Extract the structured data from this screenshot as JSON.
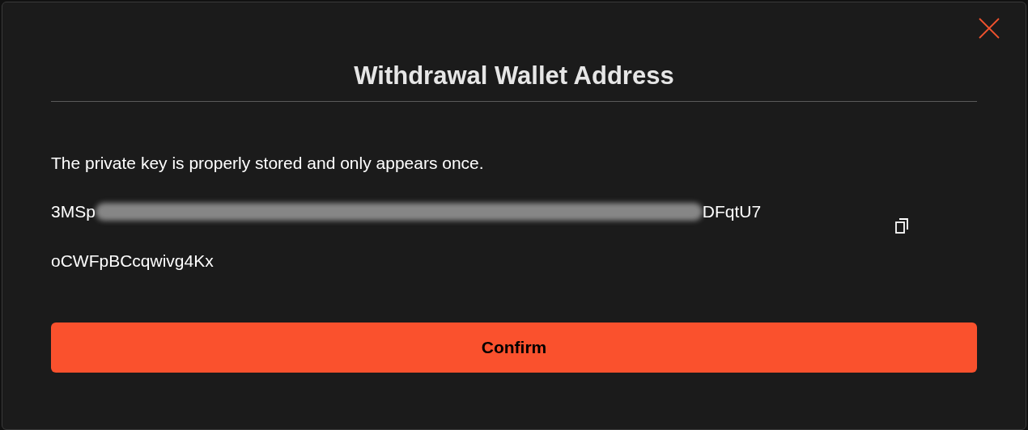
{
  "dialog": {
    "title": "Withdrawal Wallet Address",
    "message": "The private key is properly stored and only appears once.",
    "address": {
      "line_1_start": "3MSp",
      "line_1_end": "DFqtU7",
      "line_2": "oCWFpBCcqwivg4Kx",
      "redacted": true
    },
    "confirm_button": "Confirm"
  }
}
